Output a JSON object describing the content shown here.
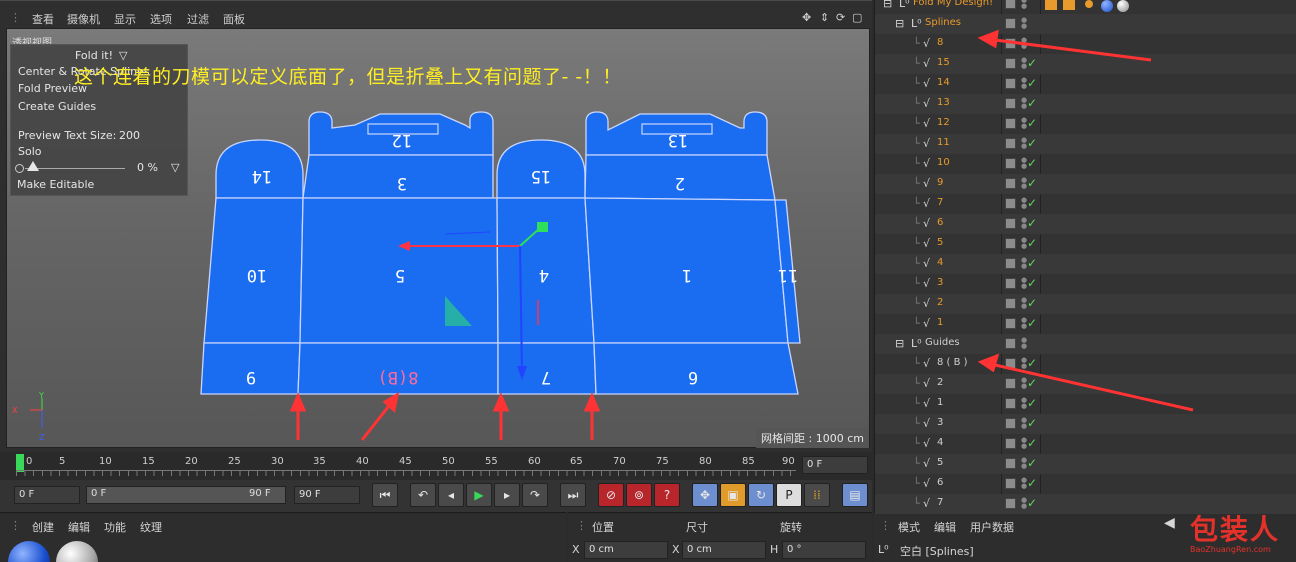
{
  "viewport": {
    "menu": [
      "查看",
      "摄像机",
      "显示",
      "选项",
      "过滤",
      "面板"
    ],
    "label": "透视视图",
    "grid_spacing": "网格间距 : 1000 cm",
    "annotation": "这个连着的刀模可以定义底面了，但是折叠上又有问题了- -！！",
    "fold_panel": {
      "title": "Fold it!",
      "center_rotate": "Center & Rotate Splines",
      "fold_preview": "Fold Preview",
      "create_guides": "Create Guides",
      "preview_text_size_label": "Preview Text Size:",
      "preview_text_size_value": "200",
      "solo": "Solo",
      "slider_value": "0 %",
      "make_editable": "Make Editable"
    },
    "panel_labels": [
      "14",
      "3",
      "12",
      "15",
      "2",
      "13",
      "10",
      "5",
      "4",
      "1",
      "11",
      "9",
      "8(B)",
      "7",
      "6"
    ]
  },
  "timeline": {
    "ticks": [
      "0",
      "5",
      "10",
      "15",
      "20",
      "25",
      "30",
      "35",
      "40",
      "45",
      "50",
      "55",
      "60",
      "65",
      "70",
      "75",
      "80",
      "85",
      "90"
    ],
    "current_frame_field": "0 F",
    "start_field": "0 F",
    "range_start": "0 F",
    "range_end": "90 F",
    "end_field": "90 F"
  },
  "materials": {
    "menu": [
      "创建",
      "编辑",
      "功能",
      "纹理"
    ]
  },
  "coords": {
    "headers": [
      "位置",
      "尺寸",
      "旋转"
    ],
    "x_label": "X",
    "x_pos": "0 cm",
    "x2_label": "X",
    "x_size": "0 cm",
    "h_label": "H",
    "h_rot": "0 °"
  },
  "attributes": {
    "menu": [
      "模式",
      "编辑",
      "用户数据"
    ],
    "object": "空白 [Splines]"
  },
  "object_manager": {
    "root": "Fold My Design!",
    "splines_group": "Splines",
    "splines": [
      "8",
      "15",
      "14",
      "13",
      "12",
      "11",
      "10",
      "9",
      "7",
      "6",
      "5",
      "4",
      "3",
      "2",
      "1"
    ],
    "guides_group": "Guides",
    "guides": [
      "8 ( B )",
      "2",
      "1",
      "3",
      "4",
      "5",
      "6",
      "7"
    ]
  },
  "watermark": {
    "brand": "包装人",
    "url": "BaoZhuangRen.com"
  },
  "colors": {
    "panel_blue": "#1a6cf0",
    "annotation": "#ffee22",
    "spline_orange": "#e89a2c",
    "check_green": "#5fd65f",
    "arrow_red": "#ff3333"
  }
}
